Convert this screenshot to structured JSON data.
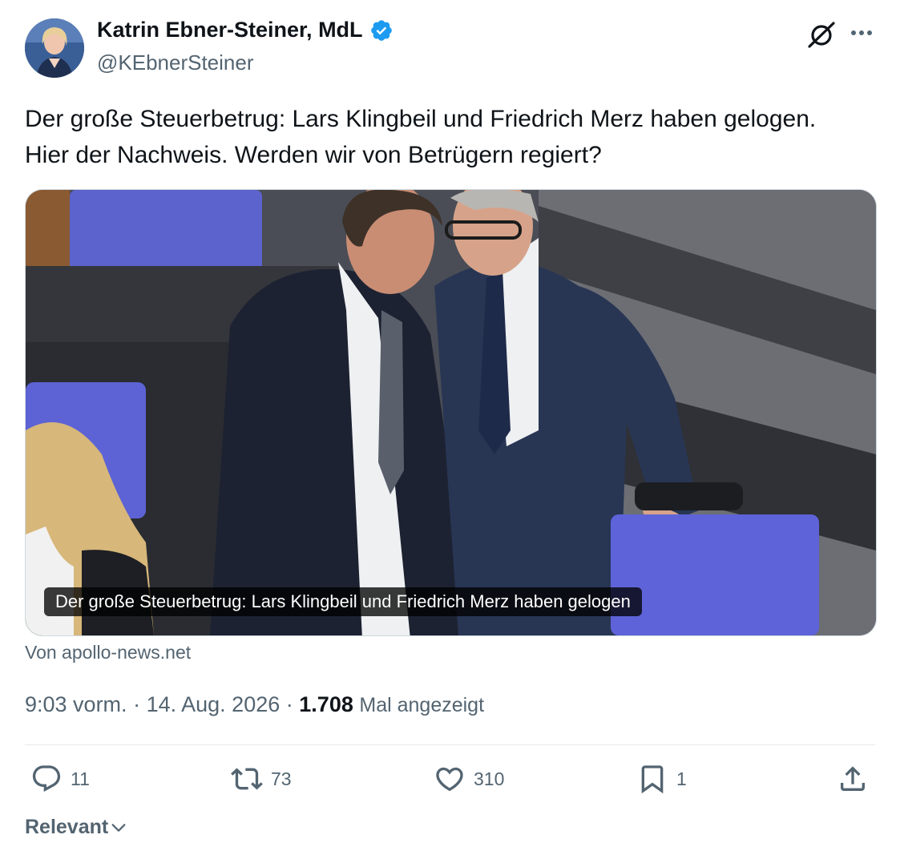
{
  "author": {
    "name": "Katrin Ebner-Steiner, MdL",
    "handle": "@KEbnerSteiner",
    "verified_color": "#1d9bf0"
  },
  "tweet": {
    "line1": "Der große Steuerbetrug: Lars Klingbeil und Friedrich Merz haben gelogen.",
    "line2": "Hier der Nachweis. Werden wir von Betrügern regiert?"
  },
  "card": {
    "caption": "Der große Steuerbetrug: Lars Klingbeil und Friedrich Merz haben gelogen",
    "source": "Von apollo-news.net"
  },
  "meta": {
    "time": "9:03 vorm.",
    "date": "14. Aug. 2026",
    "views_count": "1.708",
    "views_label": "Mal angezeigt",
    "separator": "·"
  },
  "actions": {
    "replies": "11",
    "reposts": "73",
    "likes": "310",
    "bookmarks": "1"
  },
  "sort": {
    "label": "Relevant"
  },
  "icons": [
    "verified-badge-icon",
    "grok-icon",
    "more-icon",
    "reply-icon",
    "repost-icon",
    "like-icon",
    "bookmark-icon",
    "share-icon",
    "chevron-down-icon"
  ]
}
